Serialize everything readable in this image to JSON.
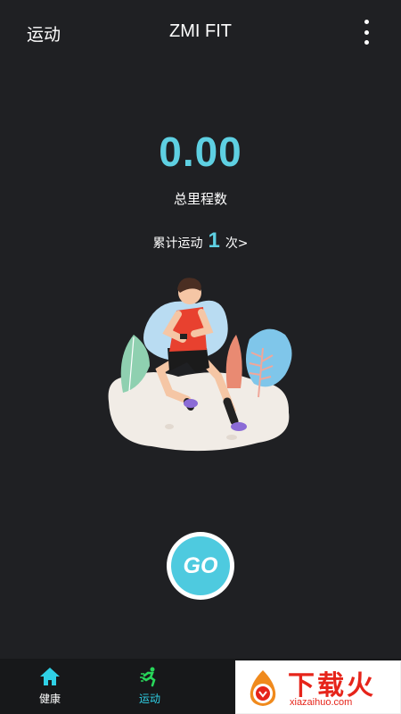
{
  "header": {
    "left_label": "运动",
    "title": "ZMI FIT",
    "menu_icon": "more-vertical-icon"
  },
  "stats": {
    "total_distance": "0.00",
    "total_distance_label": "总里程数",
    "count_prefix": "累计运动",
    "count_value": "1",
    "count_suffix": "次>"
  },
  "illustration": {
    "subject": "runner-illustration"
  },
  "go_button": {
    "label": "GO",
    "color": "#4ecadf"
  },
  "tabbar": {
    "tabs": [
      {
        "label": "健康",
        "icon": "home-icon",
        "active": false
      },
      {
        "label": "运动",
        "icon": "running-icon",
        "active": true
      }
    ]
  },
  "watermark": {
    "brand": "下载火",
    "site": "xiazaihuo.com"
  },
  "colors": {
    "accent": "#5ed0e2",
    "background": "#1f2023",
    "active_tab": "#2fd0e6"
  }
}
